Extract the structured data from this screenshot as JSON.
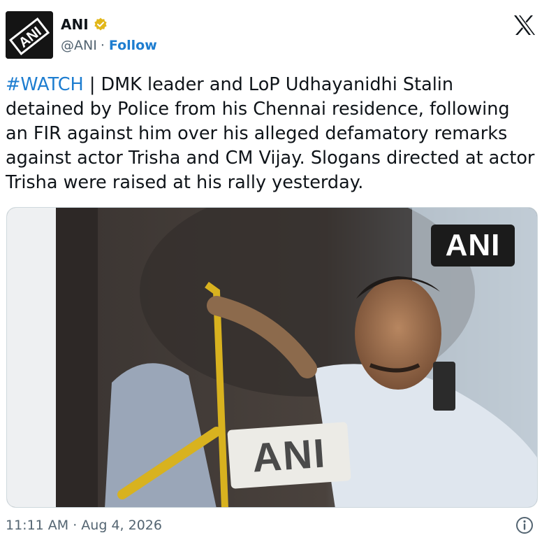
{
  "author": {
    "name": "ANI",
    "handle": "@ANI",
    "separator": "·",
    "follow_label": "Follow",
    "avatar_icon": "ani-logo-avatar",
    "verified_icon": "gold-verified-badge-icon"
  },
  "tweet": {
    "hashtag": "#WATCH",
    "body": " | DMK leader and LoP Udhayanidhi Stalin detained by Police from his Chennai residence, following an FIR against him over his alleged defamatory remarks against actor Trisha and CM Vijay. Slogans directed at actor Trisha were raised at his rally yesterday."
  },
  "media": {
    "watermark": "ANI",
    "mic_label": "ANI"
  },
  "footer": {
    "timestamp": "11:11 AM · Aug 4, 2026"
  },
  "icons": {
    "x_logo": "x-logo-icon",
    "info": "info-icon"
  },
  "colors": {
    "link_blue": "#1d7dd0",
    "secondary_text": "#536471",
    "verified_gold": "#e2b719"
  }
}
